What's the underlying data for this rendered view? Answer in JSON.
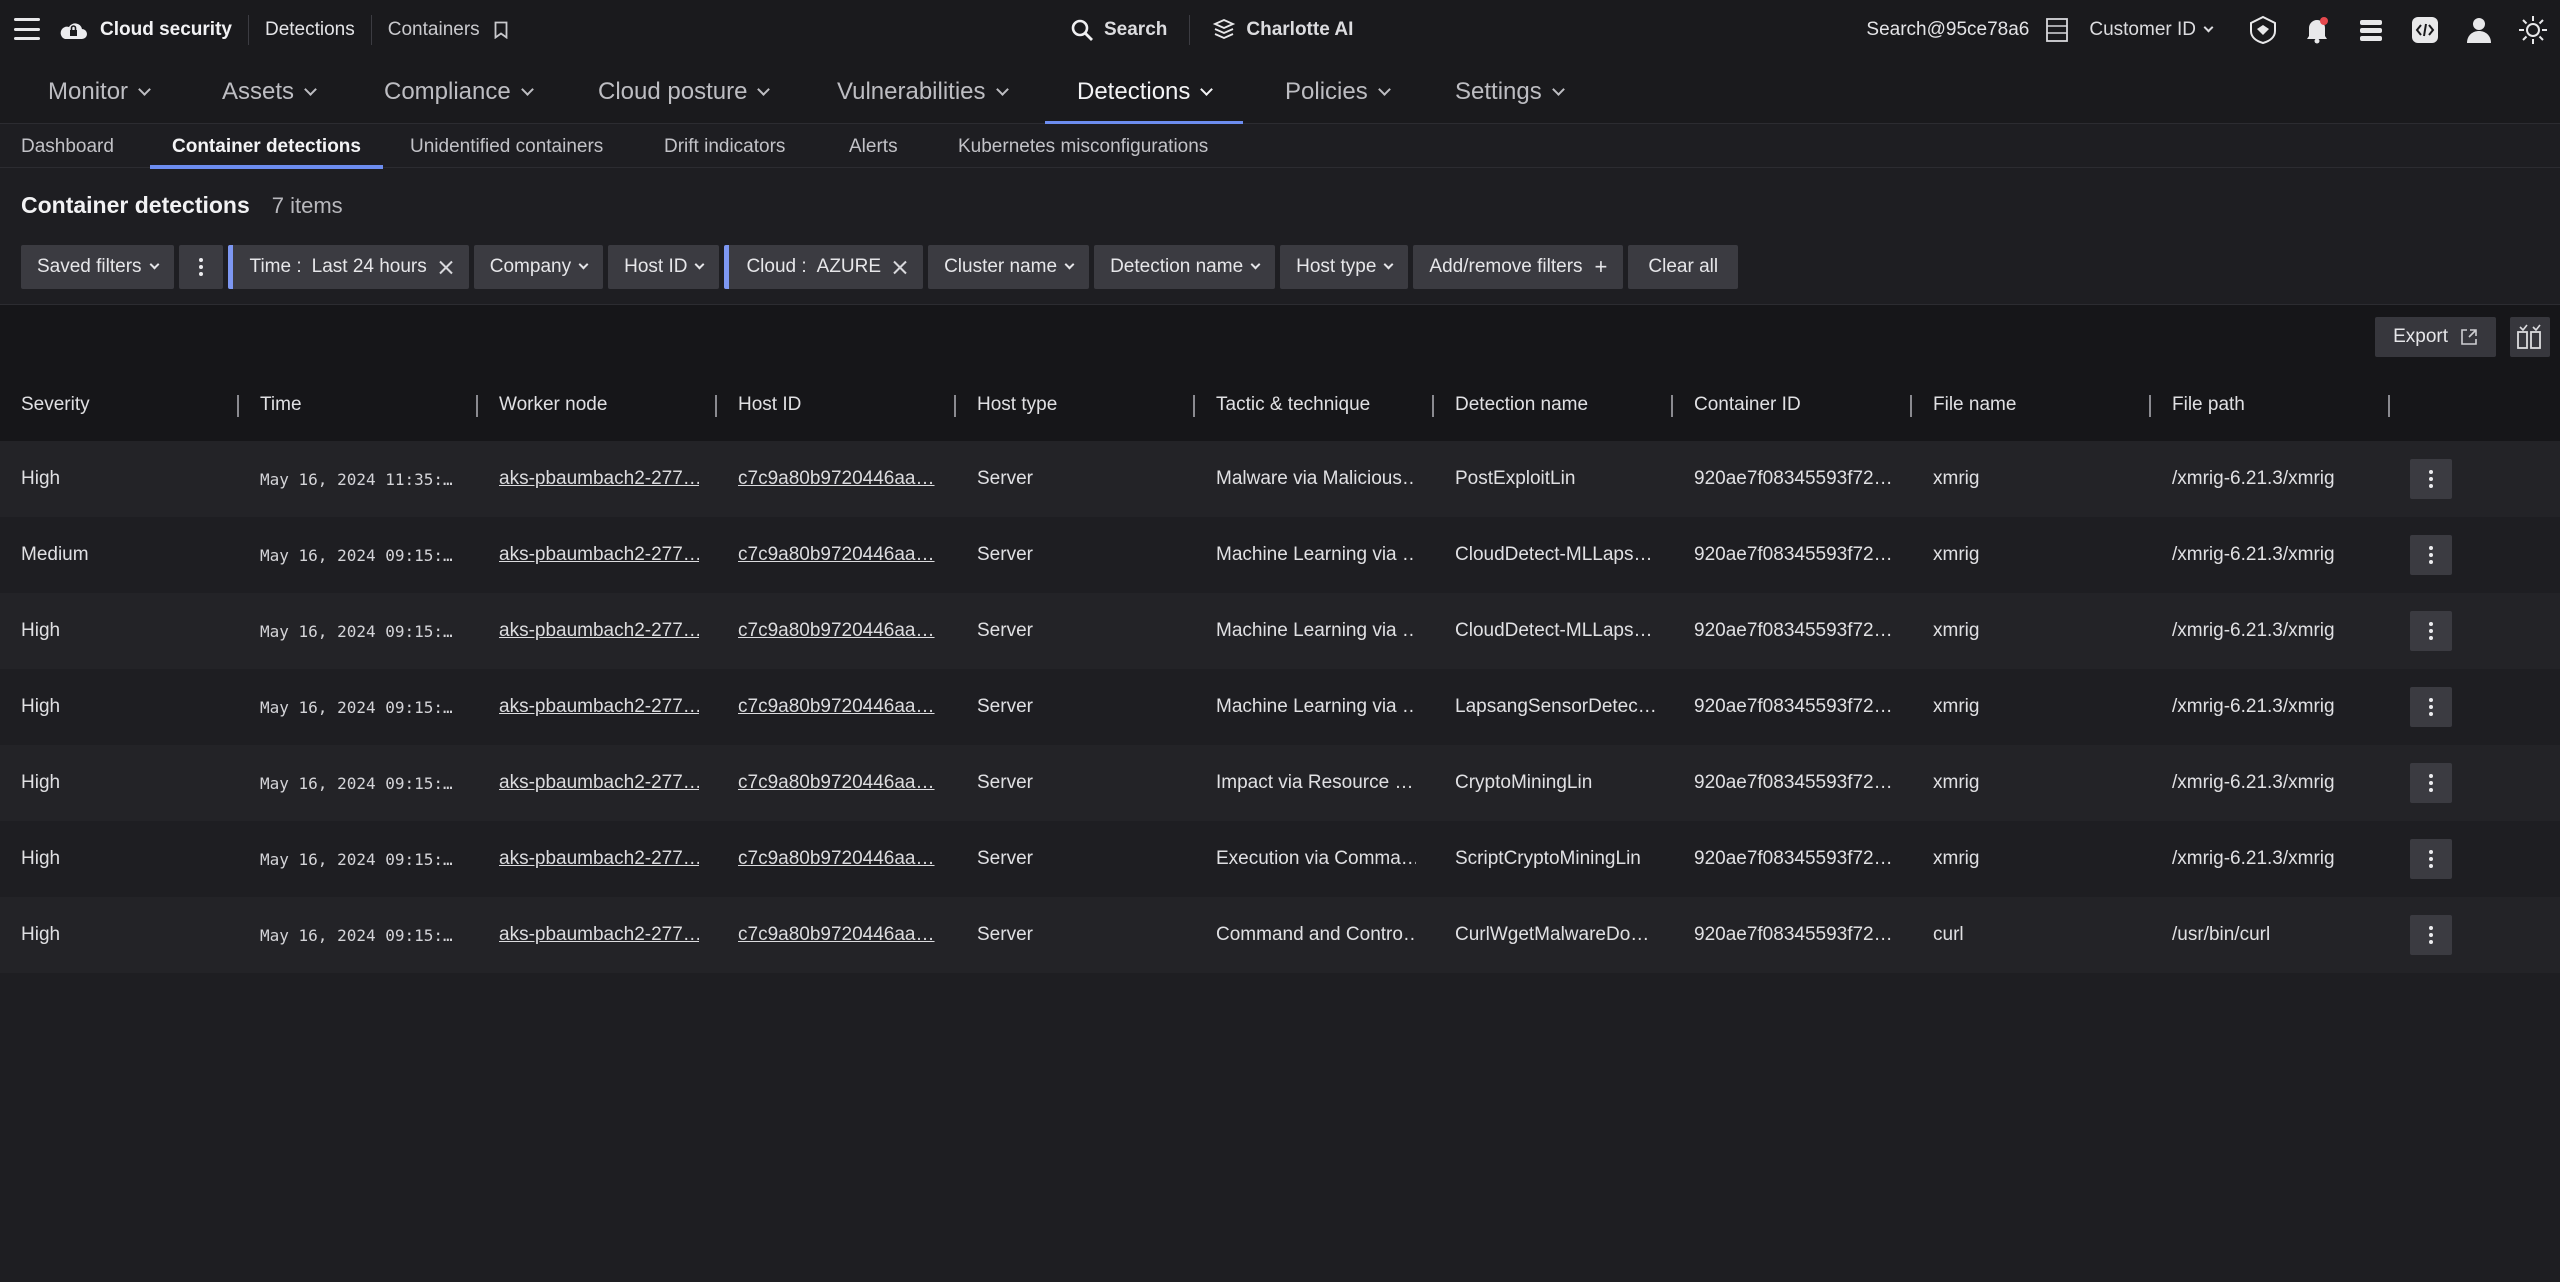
{
  "topbar": {
    "breadcrumbs": [
      "Cloud security",
      "Detections",
      "Containers"
    ],
    "search_label": "Search",
    "ai_label": "Charlotte AI",
    "account": "Search@95ce78a6",
    "customer_label": "Customer ID"
  },
  "mainnav": {
    "items": [
      "Monitor",
      "Assets",
      "Compliance",
      "Cloud posture",
      "Vulnerabilities",
      "Detections",
      "Policies",
      "Settings"
    ],
    "active": "Detections"
  },
  "subnav": {
    "items": [
      "Dashboard",
      "Container detections",
      "Unidentified containers",
      "Drift indicators",
      "Alerts",
      "Kubernetes misconfigurations"
    ],
    "active": "Container detections"
  },
  "page": {
    "title": "Container detections",
    "count": "7 items"
  },
  "filters": {
    "saved": "Saved filters",
    "time_key": "Time :",
    "time_value": "Last 24 hours",
    "company": "Company",
    "host_id": "Host ID",
    "cloud_key": "Cloud :",
    "cloud_value": "AZURE",
    "cluster": "Cluster name",
    "detection": "Detection name",
    "host_type": "Host type",
    "add_remove": "Add/remove filters",
    "clear": "Clear all"
  },
  "toolbar": {
    "export": "Export"
  },
  "table": {
    "columns": [
      "Severity",
      "Time",
      "Worker node",
      "Host ID",
      "Host type",
      "Tactic & technique",
      "Detection name",
      "Container ID",
      "File name",
      "File path"
    ],
    "rows": [
      [
        "High",
        "May 16, 2024 11:35:…",
        "aks-pbaumbach2-277…",
        "c7c9a80b9720446aa…",
        "Server",
        "Malware via Malicious…",
        "PostExploitLin",
        "920ae7f08345593f72…",
        "xmrig",
        "/xmrig-6.21.3/xmrig"
      ],
      [
        "Medium",
        "May 16, 2024 09:15:…",
        "aks-pbaumbach2-277…",
        "c7c9a80b9720446aa…",
        "Server",
        "Machine Learning via …",
        "CloudDetect-MLLaps…",
        "920ae7f08345593f72…",
        "xmrig",
        "/xmrig-6.21.3/xmrig"
      ],
      [
        "High",
        "May 16, 2024 09:15:…",
        "aks-pbaumbach2-277…",
        "c7c9a80b9720446aa…",
        "Server",
        "Machine Learning via …",
        "CloudDetect-MLLaps…",
        "920ae7f08345593f72…",
        "xmrig",
        "/xmrig-6.21.3/xmrig"
      ],
      [
        "High",
        "May 16, 2024 09:15:…",
        "aks-pbaumbach2-277…",
        "c7c9a80b9720446aa…",
        "Server",
        "Machine Learning via …",
        "LapsangSensorDetec…",
        "920ae7f08345593f72…",
        "xmrig",
        "/xmrig-6.21.3/xmrig"
      ],
      [
        "High",
        "May 16, 2024 09:15:…",
        "aks-pbaumbach2-277…",
        "c7c9a80b9720446aa…",
        "Server",
        "Impact via Resource …",
        "CryptoMiningLin",
        "920ae7f08345593f72…",
        "xmrig",
        "/xmrig-6.21.3/xmrig"
      ],
      [
        "High",
        "May 16, 2024 09:15:…",
        "aks-pbaumbach2-277…",
        "c7c9a80b9720446aa…",
        "Server",
        "Execution via Comma…",
        "ScriptCryptoMiningLin",
        "920ae7f08345593f72…",
        "xmrig",
        "/xmrig-6.21.3/xmrig"
      ],
      [
        "High",
        "May 16, 2024 09:15:…",
        "aks-pbaumbach2-277…",
        "c7c9a80b9720446aa…",
        "Server",
        "Command and Contro…",
        "CurlWgetMalwareDo…",
        "920ae7f08345593f72…",
        "curl",
        "/usr/bin/curl"
      ]
    ]
  },
  "colors": {
    "accent": "#6d8df0",
    "notification": "#e5484d"
  }
}
